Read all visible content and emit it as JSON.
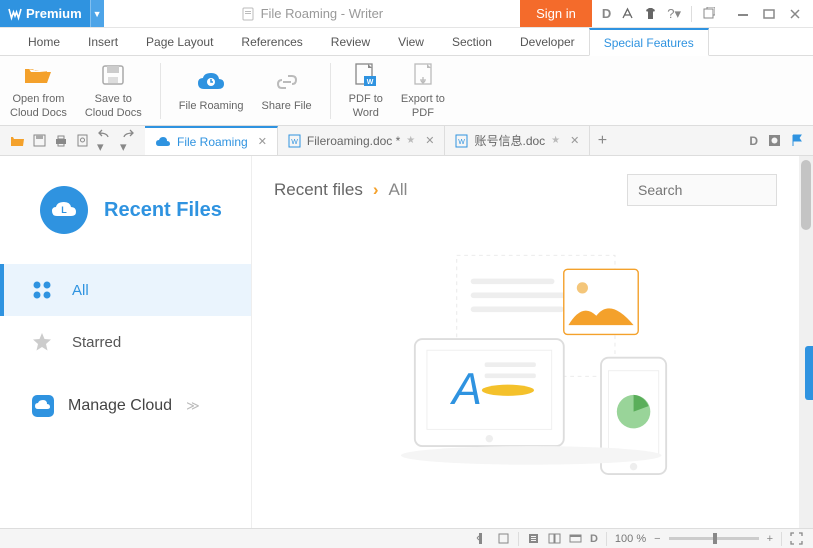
{
  "titlebar": {
    "premium": "Premium",
    "title": "File Roaming - Writer",
    "signin": "Sign in"
  },
  "menutabs": [
    {
      "label": "Home"
    },
    {
      "label": "Insert"
    },
    {
      "label": "Page Layout"
    },
    {
      "label": "References"
    },
    {
      "label": "Review"
    },
    {
      "label": "View"
    },
    {
      "label": "Section"
    },
    {
      "label": "Developer"
    },
    {
      "label": "Special Features",
      "active": true
    }
  ],
  "ribbon": {
    "open": "Open from\nCloud Docs",
    "save": "Save to\nCloud Docs",
    "roaming": "File Roaming",
    "share": "Share File",
    "pdf": "PDF to\nWord",
    "export": "Export to\nPDF"
  },
  "doctabs": [
    {
      "label": "File Roaming",
      "active": true
    },
    {
      "label": "Fileroaming.doc *"
    },
    {
      "label": "账号信息.doc"
    }
  ],
  "sidebar": {
    "title": "Recent Files",
    "all": "All",
    "starred": "Starred",
    "manage": "Manage Cloud"
  },
  "breadcrumb": {
    "root": "Recent files",
    "current": "All"
  },
  "search": {
    "placeholder": "Search"
  },
  "status": {
    "zoom": "100 %"
  }
}
